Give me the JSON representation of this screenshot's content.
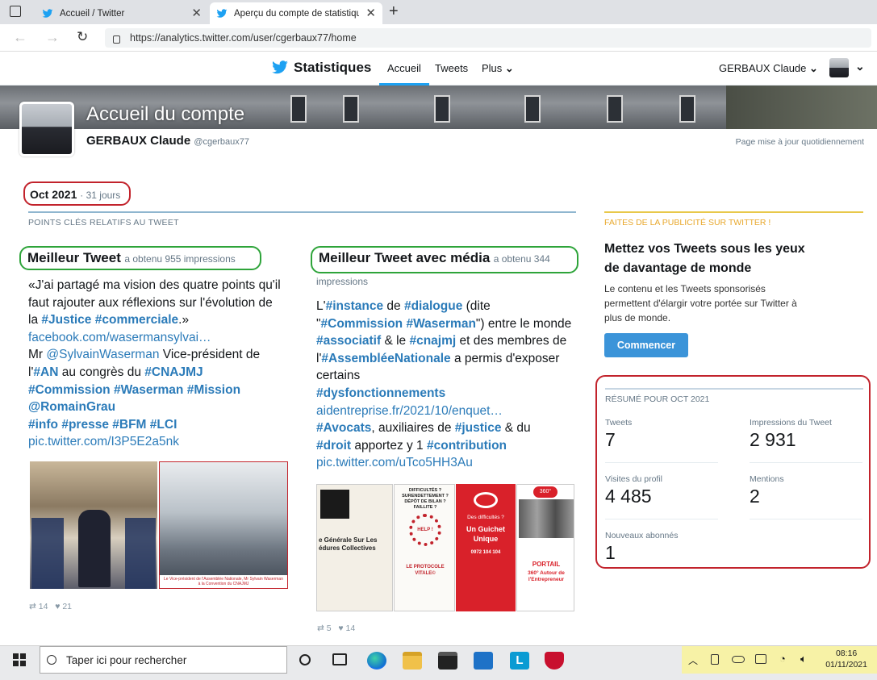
{
  "browser": {
    "tabs": [
      {
        "title": "Accueil / Twitter"
      },
      {
        "title": "Aperçu du compte de statistique"
      }
    ],
    "url": "https://analytics.twitter.com/user/cgerbaux77/home"
  },
  "header": {
    "brand": "Statistiques",
    "nav": [
      "Accueil",
      "Tweets",
      "Plus"
    ],
    "user": "GERBAUX Claude"
  },
  "account": {
    "title": "Accueil du compte",
    "name": "GERBAUX Claude",
    "handle": "@cgerbaux77",
    "updated": "Page mise à jour quotidiennement"
  },
  "period": {
    "month": "Oct 2021",
    "days": "· 31 jours"
  },
  "section_title": "POINTS CLÉS RELATIFS AU TWEET",
  "best_tweet": {
    "title": "Meilleur Tweet",
    "subtitle": "a obtenu 955 impressions",
    "t1": "«J'ai partagé ma vision des quatre points qu'il faut rajouter aux réflexions sur l'évolution de la ",
    "h1": "#Justice",
    "h2": "#commerciale",
    "t2": ".»",
    "link1": "facebook.com/wasermansylvai…",
    "t3": "Mr ",
    "m1": "@SylvainWaserman",
    "t4": " Vice-président de l'",
    "h3": "#AN",
    "t5": " au congrès du ",
    "h4": "#CNAJMJ",
    "h5": "#Commission",
    "h6": "#Waserman",
    "h7": "#Mission",
    "m2": "@RomainGrau",
    "h8": "#info",
    "h9": "#presse",
    "h10": "#BFM",
    "h11": "#LCI",
    "link2": "pic.twitter.com/I3P5E2a5nk",
    "img_caption": "Le Vice-président de l'Assemblée Nationale, Mr Sylvain Waserman à la Convention du CNAJMJ",
    "retweets": "14",
    "likes": "21"
  },
  "best_media_tweet": {
    "title": "Meilleur Tweet avec média",
    "subtitle": "a obtenu 344",
    "subtitle2": "impressions",
    "t1": "L'",
    "h1": "#instance",
    "t2": " de ",
    "h2": "#dialogue",
    "t3": " (dite \"",
    "h3": "#Commission",
    "h4": "#Waserman",
    "t4": "\") entre le monde ",
    "h5": "#associatif",
    "t5": " & le ",
    "h6": "#cnajmj",
    "t6": " et des membres de l'",
    "h7": "#AssembléeNationale",
    "t7": " a permis d'exposer certains",
    "h8": "#dysfonctionnements",
    "link1": "aidentreprise.fr/2021/10/enquet…",
    "h9": "#Avocats",
    "t8": ", auxiliaires de ",
    "h10": "#justice",
    "t9": " & du",
    "h11": "#droit",
    "t10": " apportez y 1 ",
    "h12": "#contribution",
    "link2": "pic.twitter.com/uTco5HH3Au",
    "panels": {
      "p1": "e Générale Sur Les\nédures Collectives",
      "p2_top": "DIFFICULTÉS ?\nSURENDETTEMENT ?\nDÉPÔT DE BILAN ?\nFAILLITE ?",
      "p2_help": "HELP !",
      "p2_bottom": "LE PROTOCOLE\nVITALE©",
      "p3_title": "Un Guichet\nUnique",
      "p3_sub": "Des difficultés ?",
      "p3_phone": "0972 104 104",
      "p4_badge": "360°",
      "p4_title": "PORTAIL",
      "p4_sub": "360° Autour de\nl'Entrepreneur"
    },
    "retweets": "5",
    "likes": "14"
  },
  "ad": {
    "label": "FAITES DE LA PUBLICITÉ SUR TWITTER !",
    "title": "Mettez vos Tweets sous les yeux de davantage de monde",
    "text": "Le contenu et les Tweets sponsorisés permettent d'élargir votre portée sur Twitter à plus de monde.",
    "button": "Commencer"
  },
  "summary": {
    "title": "RÉSUMÉ POUR OCT 2021",
    "tweets_label": "Tweets",
    "tweets": "7",
    "impressions_label": "Impressions du Tweet",
    "impressions": "2 931",
    "visits_label": "Visites du profil",
    "visits": "4 485",
    "mentions_label": "Mentions",
    "mentions": "2",
    "followers_label": "Nouveaux abonnés",
    "followers": "1"
  },
  "taskbar": {
    "search_placeholder": "Taper ici pour rechercher",
    "time": "08:16",
    "date": "01/11/2021"
  },
  "colors": {
    "twitter_blue": "#1da1f2",
    "link_blue": "#2b7bb9",
    "highlight_red": "#c2232c",
    "highlight_green": "#2ea43a",
    "ad_yellow": "#e8c84a"
  }
}
